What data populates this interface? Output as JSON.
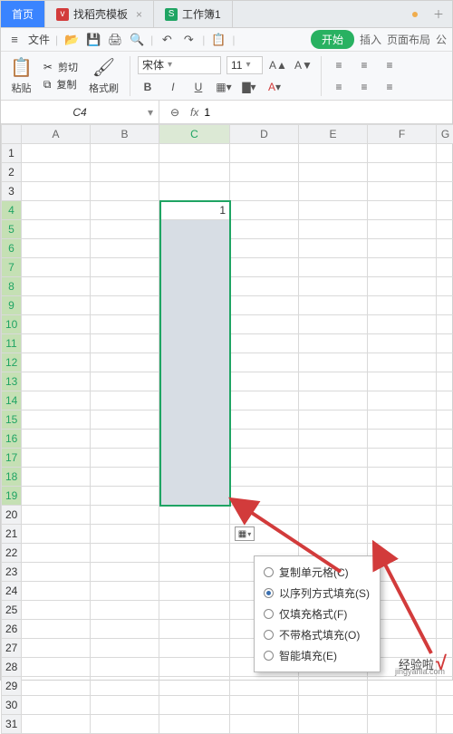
{
  "tabs": {
    "home": "首页",
    "templates": "找稻壳模板",
    "workbook": "工作簿1"
  },
  "menubar": {
    "filemenu": "文件"
  },
  "ribbon_tabs": {
    "start": "开始",
    "insert": "插入",
    "layout": "页面布局",
    "more": "公"
  },
  "clipboard": {
    "cut": "剪切",
    "copy": "复制",
    "paste": "粘贴",
    "formatpaint": "格式刷"
  },
  "font": {
    "name": "宋体",
    "size": "11"
  },
  "namebox": "C4",
  "formula": "1",
  "columns": [
    "A",
    "B",
    "C",
    "D",
    "E",
    "F",
    "G"
  ],
  "rows": [
    "1",
    "2",
    "3",
    "4",
    "5",
    "6",
    "7",
    "8",
    "9",
    "10",
    "11",
    "12",
    "13",
    "14",
    "15",
    "16",
    "17",
    "18",
    "19",
    "20",
    "21",
    "22",
    "23",
    "24",
    "25",
    "26",
    "27",
    "28",
    "29",
    "30",
    "31"
  ],
  "cellval": "1",
  "fill_options": {
    "copy": "复制单元格(C)",
    "series": "以序列方式填充(S)",
    "format": "仅填充格式(F)",
    "noformat": "不带格式填充(O)",
    "smart": "智能填充(E)"
  },
  "watermark": {
    "brand": "经验啦",
    "url": "jingyanla.com"
  },
  "chart_data": null
}
